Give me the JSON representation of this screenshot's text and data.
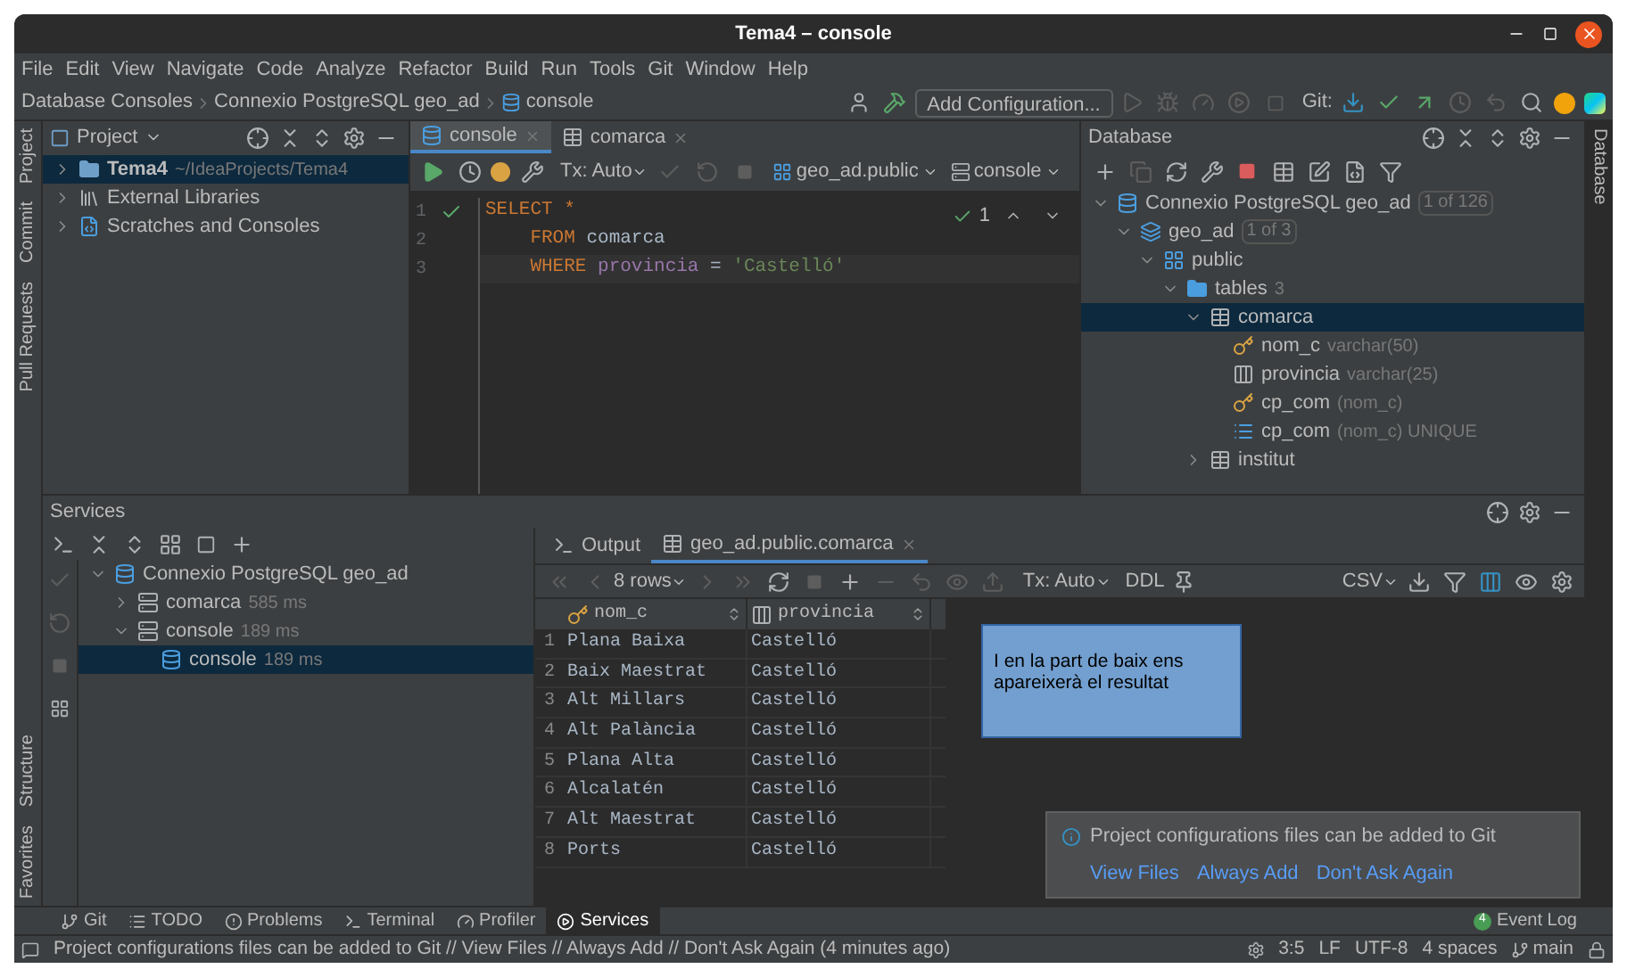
{
  "window": {
    "title": "Tema4 – console"
  },
  "menu": [
    "File",
    "Edit",
    "View",
    "Navigate",
    "Code",
    "Analyze",
    "Refactor",
    "Build",
    "Run",
    "Tools",
    "Git",
    "Window",
    "Help"
  ],
  "breadcrumbs": [
    "Database Consoles",
    "Connexio PostgreSQL geo_ad",
    "console"
  ],
  "toolbar": {
    "configuration": "Add Configuration...",
    "git_label": "Git:"
  },
  "left_stripe": {
    "top": [
      "Project",
      "Commit",
      "Pull Requests"
    ],
    "bottom": [
      "Structure",
      "Favorites"
    ]
  },
  "right_stripe": [
    "Database"
  ],
  "project": {
    "title": "Project",
    "items": [
      {
        "kind": "module",
        "label": "Tema4",
        "detail": "~/IdeaProjects/Tema4",
        "selected": true,
        "expanded": false
      },
      {
        "kind": "libraries",
        "label": "External Libraries",
        "selected": false,
        "expanded": false
      },
      {
        "kind": "scratches",
        "label": "Scratches and Consoles",
        "selected": false,
        "expanded": false
      }
    ]
  },
  "editor": {
    "tabs": [
      {
        "kind": "console",
        "label": "console",
        "selected": true
      },
      {
        "kind": "table",
        "label": "comarca",
        "selected": false
      }
    ],
    "tx": "Tx: Auto",
    "schema": "geo_ad.public",
    "session": "console",
    "inspections": "1",
    "lines": [
      {
        "number": "1",
        "ok": true,
        "tokens": [
          {
            "kind": "keyword",
            "text": "SELECT"
          },
          {
            "kind": "keyword",
            "text": " *"
          }
        ]
      },
      {
        "number": "2",
        "ok": false,
        "tokens": [
          {
            "kind": "keyword",
            "text": "    FROM"
          },
          {
            "kind": "plain",
            "text": " comarca"
          }
        ]
      },
      {
        "number": "3",
        "ok": false,
        "tokens": [
          {
            "kind": "keyword",
            "text": "    WHERE"
          },
          {
            "kind": "field",
            "text": " provincia"
          },
          {
            "kind": "plain",
            "text": " ="
          },
          {
            "kind": "string",
            "text": " 'Castelló'"
          }
        ]
      }
    ]
  },
  "database": {
    "title": "Database",
    "tree": [
      {
        "kind": "connection",
        "label": "Connexio PostgreSQL geo_ad",
        "badge": "1 of 126",
        "expanded": true,
        "selected": false,
        "children": [
          {
            "kind": "database",
            "label": "geo_ad",
            "badge": "1 of 3",
            "expanded": true,
            "selected": false,
            "children": [
              {
                "kind": "schema",
                "label": "public",
                "expanded": true,
                "selected": false,
                "children": [
                  {
                    "kind": "folder",
                    "label": "tables",
                    "count": "3",
                    "expanded": true,
                    "selected": false,
                    "children": [
                      {
                        "kind": "table",
                        "label": "comarca",
                        "expanded": true,
                        "selected": true,
                        "children": [
                          {
                            "kind": "keycolumn",
                            "label": "nom_c",
                            "detail": "varchar(50)",
                            "selected": false
                          },
                          {
                            "kind": "column",
                            "label": "provincia",
                            "detail": "varchar(25)",
                            "selected": false
                          },
                          {
                            "kind": "key",
                            "label": "cp_com",
                            "detail": "(nom_c)",
                            "selected": false
                          },
                          {
                            "kind": "index",
                            "label": "cp_com",
                            "detail": "(nom_c) UNIQUE",
                            "selected": false
                          }
                        ]
                      },
                      {
                        "kind": "table",
                        "label": "institut",
                        "expanded": false,
                        "selected": false
                      }
                    ]
                  }
                ]
              }
            ]
          }
        ]
      }
    ]
  },
  "services": {
    "title": "Services",
    "tree": [
      {
        "kind": "connection",
        "label": "Connexio PostgreSQL geo_ad",
        "expanded": true,
        "selected": false,
        "children": [
          {
            "kind": "session",
            "label": "comarca",
            "detail": "585 ms",
            "expanded": false,
            "selected": false
          },
          {
            "kind": "session",
            "label": "console",
            "detail": "189 ms",
            "expanded": true,
            "selected": false,
            "children": [
              {
                "kind": "console",
                "label": "console",
                "detail": "189 ms",
                "selected": true
              }
            ]
          }
        ]
      }
    ]
  },
  "results": {
    "tabs": [
      {
        "kind": "output",
        "label": "Output",
        "selected": false
      },
      {
        "kind": "table",
        "label": "geo_ad.public.comarca",
        "selected": true
      }
    ],
    "rows_label": "8 rows",
    "tx": "Tx: Auto",
    "ddl": "DDL",
    "format": "CSV",
    "columns": [
      {
        "kind": "keycolumn",
        "label": "nom_c"
      },
      {
        "kind": "column",
        "label": "provincia"
      }
    ],
    "rows": [
      {
        "number": "1",
        "cells": [
          "Plana Baixa",
          "Castelló"
        ]
      },
      {
        "number": "2",
        "cells": [
          "Baix Maestrat",
          "Castelló"
        ]
      },
      {
        "number": "3",
        "cells": [
          "Alt Millars",
          "Castelló"
        ]
      },
      {
        "number": "4",
        "cells": [
          "Alt Palància",
          "Castelló"
        ]
      },
      {
        "number": "5",
        "cells": [
          "Plana Alta",
          "Castelló"
        ]
      },
      {
        "number": "6",
        "cells": [
          "Alcalatén",
          "Castelló"
        ]
      },
      {
        "number": "7",
        "cells": [
          "Alt Maestrat",
          "Castelló"
        ]
      },
      {
        "number": "8",
        "cells": [
          "Ports",
          "Castelló"
        ]
      }
    ]
  },
  "annotation": {
    "text": "I en la part de baix ens apareixerà el resultat"
  },
  "notification": {
    "message": "Project configurations files can be added to Git",
    "actions": [
      "View Files",
      "Always Add",
      "Don't Ask Again"
    ]
  },
  "bottom_tabs": [
    {
      "kind": "git",
      "label": "Git",
      "selected": false
    },
    {
      "kind": "todo",
      "label": "TODO",
      "selected": false
    },
    {
      "kind": "problems",
      "label": "Problems",
      "selected": false
    },
    {
      "kind": "terminal",
      "label": "Terminal",
      "selected": false
    },
    {
      "kind": "profiler",
      "label": "Profiler",
      "selected": false
    },
    {
      "kind": "services",
      "label": "Services",
      "selected": true
    }
  ],
  "event_log": {
    "label": "Event Log",
    "count": "4"
  },
  "status_bar": {
    "message": "Project configurations files can be added to Git // View Files // Always Add // Don't Ask Again (4 minutes ago)",
    "position": "3:5",
    "line_separator": "LF",
    "encoding": "UTF-8",
    "indent": "4 spaces",
    "branch": "main"
  }
}
